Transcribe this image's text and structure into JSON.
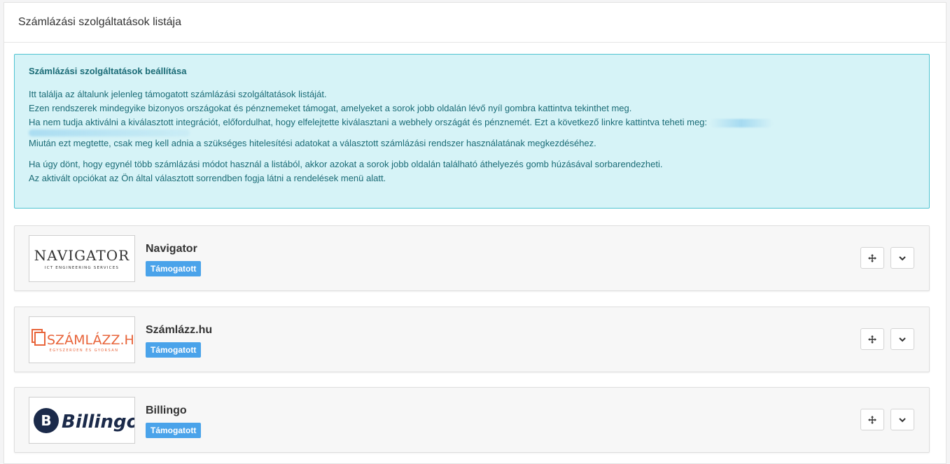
{
  "header": {
    "title": "Számlázási szolgáltatások listája"
  },
  "alert": {
    "title": "Számlázási szolgáltatások beállítása",
    "line1": "Itt találja az általunk jelenleg támogatott számlázási szolgáltatások listáját.",
    "line2": "Ezen rendszerek mindegyike bizonyos országokat és pénznemeket támogat, amelyeket a sorok jobb oldalán lévő nyíl gombra kattintva tekinthet meg.",
    "line3": "Ha nem tudja aktiválni a kiválasztott integrációt, előfordulhat, hogy elfelejtette kiválasztani a webhely országát és pénznemét. Ezt a következő linkre kattintva teheti meg:",
    "line4": "Miután ezt megtette, csak meg kell adnia a szükséges hitelesítési adatokat a választott számlázási rendszer használatának megkezdéséhez.",
    "line5": "Ha úgy dönt, hogy egynél több számlázási módot használ a listából, akkor azokat a sorok jobb oldalán található áthelyezés gomb húzásával sorbarendezheti.",
    "line6": "Az aktivált opciókat az Ön által választott sorrendben fogja látni a rendelések menü alatt."
  },
  "services": [
    {
      "name": "Navigator",
      "badge": "Támogatott",
      "logo_main": "NAVIGATOR",
      "logo_sub": "ICT ENGINEERING SERVICES"
    },
    {
      "name": "Számlázz.hu",
      "badge": "Támogatott",
      "logo_main": "SZÁMLÁZZ.HU",
      "logo_sub": "EGYSZERŰEN ÉS GYORSAN"
    },
    {
      "name": "Billingo",
      "badge": "Támogatott",
      "logo_main": "Billingo",
      "logo_sub": ""
    }
  ],
  "colors": {
    "badge": "#4aa3ea",
    "alert_bg": "#d6f3f7",
    "alert_text": "#1a6b76",
    "szamlazz": "#e8643a",
    "billingo": "#1b2a4a"
  },
  "icons": {
    "move": "move-arrows-icon",
    "expand": "chevron-down-icon"
  }
}
